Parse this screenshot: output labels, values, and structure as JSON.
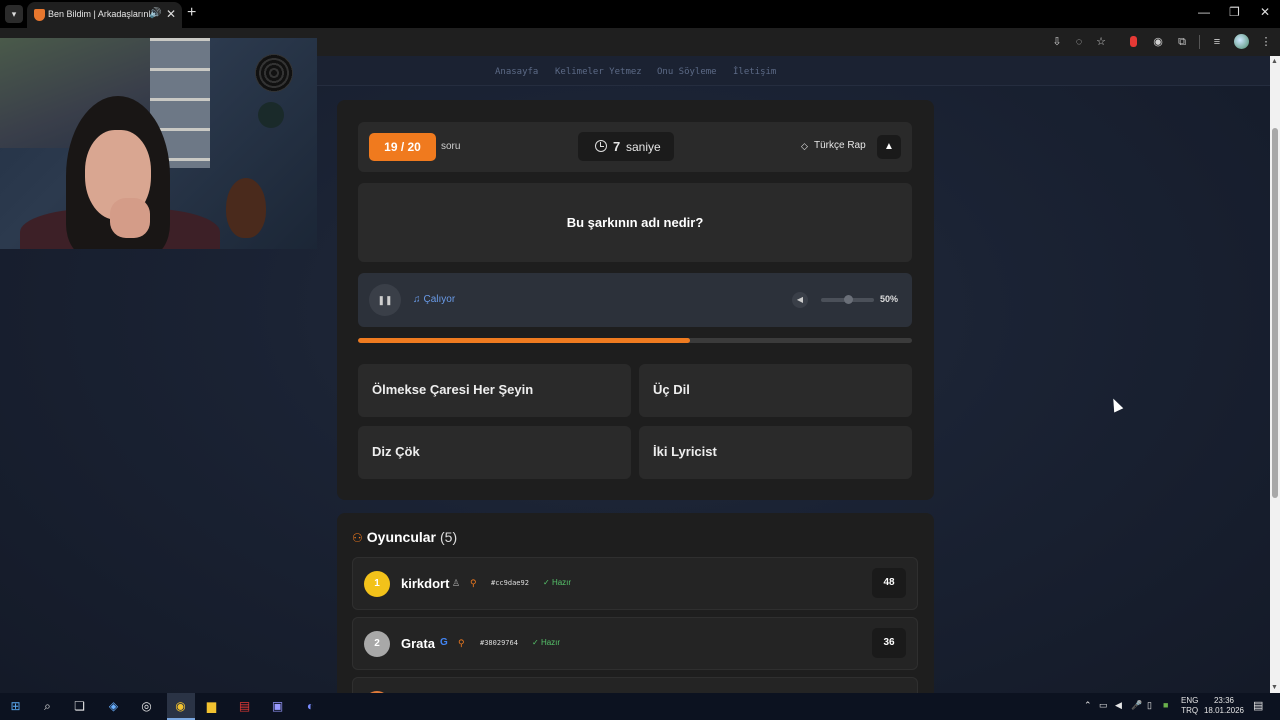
{
  "browser": {
    "tab_title": "Ben Bildim | Arkadaşlarınla",
    "tab_audio_icon": "speaker-icon",
    "new_tab": "+",
    "minimize": "—",
    "restore": "❐",
    "close": "✕"
  },
  "nav": {
    "items": [
      "Anasayfa",
      "Kelimeler Yetmez",
      "Onu Söyleme",
      "İletişim"
    ]
  },
  "quiz": {
    "question_number": "19 / 20",
    "question_label": "soru",
    "timer_value": "7",
    "timer_unit": "saniye",
    "category": "Türkçe Rap",
    "question": "Bu şarkının adı nedir?",
    "status": "Çalıyor",
    "volume_percent": 50,
    "volume_label": "50%",
    "song_progress": 0.6,
    "answers": [
      "Ölmekse Çaresi Her Şeyin",
      "Üç Dil",
      "Diz Çök",
      "İki Lyricist"
    ]
  },
  "players": {
    "title": "Oyuncular",
    "count": "(5)",
    "list": [
      {
        "rank": "1",
        "name": "kirkdort",
        "tag": "#cc9dae92",
        "status": "Hazır",
        "score": "48",
        "rank_color": "#f3c21a"
      },
      {
        "rank": "2",
        "name": "Grata",
        "tag": "#38029764",
        "status": "Hazır",
        "score": "36",
        "rank_color": "#a8a8a8"
      }
    ]
  },
  "taskbar": {
    "language": "ENG",
    "keyboard": "TRQ",
    "time": "23:36",
    "date": "18.01.2026"
  },
  "colors": {
    "accent": "#f07a1e",
    "ready": "#56c46a",
    "playing": "#6a9be8"
  }
}
